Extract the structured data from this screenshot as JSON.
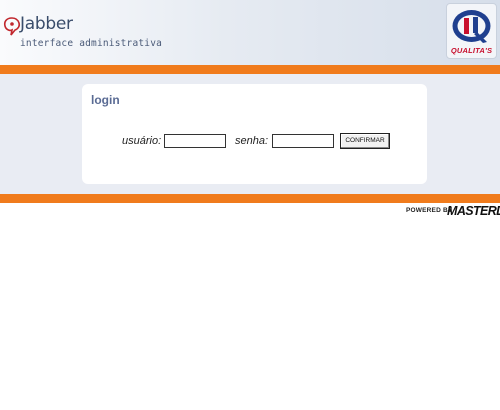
{
  "header": {
    "brand_name": "Jabber",
    "brand_subtitle": "interface administrativa",
    "partner_logo_text": "QUALITA'S"
  },
  "login": {
    "title": "login",
    "username_label": "usuário:",
    "username_value": "",
    "password_label": "senha:",
    "password_value": "",
    "confirm_label": "CONFIRMAR"
  },
  "footer": {
    "powered_by": "POWERED BY",
    "powered_brand": "MASTERDEV"
  },
  "colors": {
    "accent_orange": "#f07b1c",
    "band": "#e9ecf3",
    "title_blue": "#5a6b94",
    "partner_red": "#c8102e"
  },
  "icons": {
    "brand_mark": "jabber-logo-icon",
    "partner_logo": "qualitas-logo-icon"
  }
}
